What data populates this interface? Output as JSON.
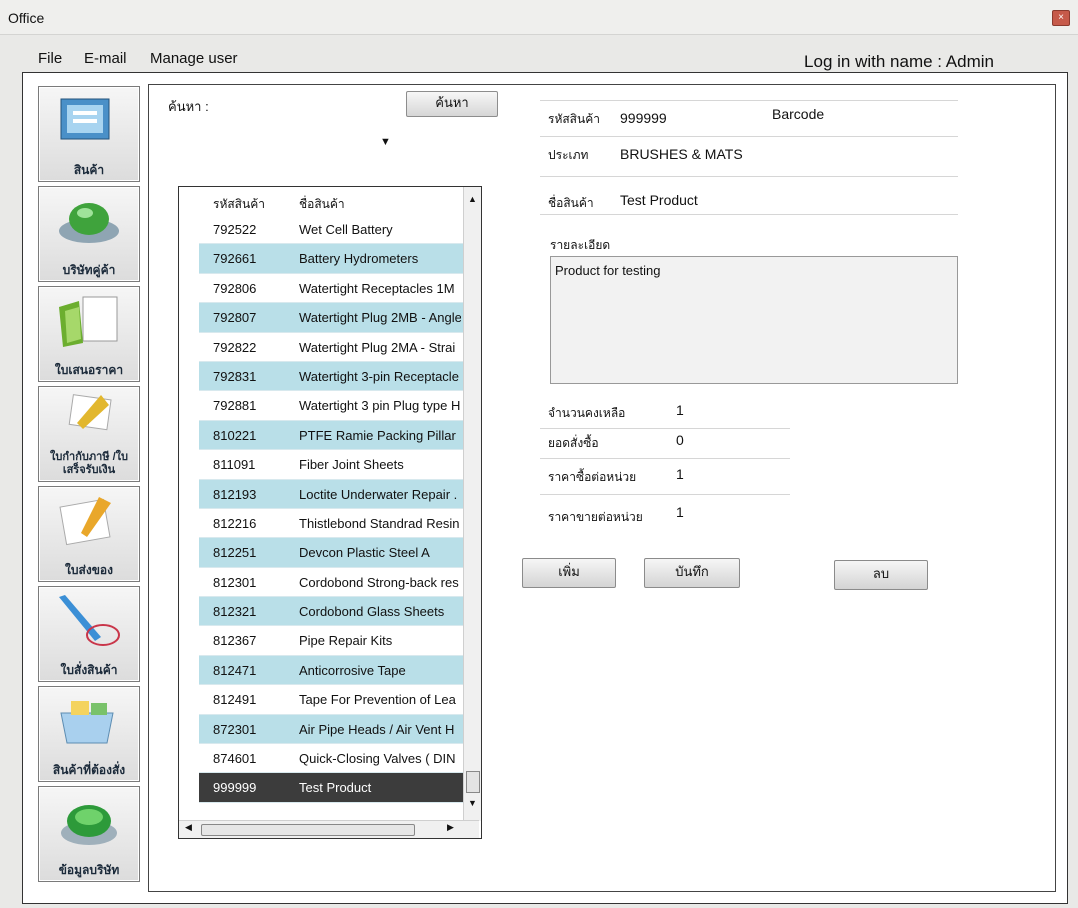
{
  "window": {
    "title": "Office",
    "close_glyph": "×"
  },
  "menu": {
    "file": "File",
    "email": "E-mail",
    "manage_user": "Manage user"
  },
  "login_text": "Log in with name : Admin",
  "sidebar": [
    {
      "label": "สินค้า",
      "icon": "product-icon"
    },
    {
      "label": "บริษัทคู่ค้า",
      "icon": "partner-company-icon"
    },
    {
      "label": "ใบเสนอราคา",
      "icon": "quotation-icon"
    },
    {
      "label": "ใบกำกับภาษี /ใบเสร็จรับเงิน",
      "icon": "invoice-icon"
    },
    {
      "label": "ใบส่งของ",
      "icon": "delivery-note-icon"
    },
    {
      "label": "ใบสั่งสินค้า",
      "icon": "purchase-order-icon"
    },
    {
      "label": "สินค้าที่ต้องสั่ง",
      "icon": "items-to-order-icon"
    },
    {
      "label": "ข้อมูลบริษัท",
      "icon": "company-info-icon"
    }
  ],
  "search": {
    "label": "ค้นหา :",
    "button": "ค้นหา",
    "dropdown_arrow": "▼"
  },
  "list": {
    "headers": {
      "code": "รหัสสินค้า",
      "name": "ชื่อสินค้า"
    },
    "rows": [
      {
        "code": "792522",
        "name": "Wet  Cell Battery"
      },
      {
        "code": "792661",
        "name": "Battery Hydrometers"
      },
      {
        "code": "792806",
        "name": " Watertight Receptacles 1M"
      },
      {
        "code": "792807",
        "name": "Watertight Plug 2MB - Angle"
      },
      {
        "code": "792822",
        "name": " Watertight Plug 2MA - Strai"
      },
      {
        "code": "792831",
        "name": "Watertight 3-pin Receptacle"
      },
      {
        "code": "792881",
        "name": "Watertight 3 pin Plug type H"
      },
      {
        "code": "810221",
        "name": "PTFE Ramie Packing Pillar"
      },
      {
        "code": "811091",
        "name": "Fiber Joint Sheets"
      },
      {
        "code": "812193",
        "name": "Loctite Underwater Repair ."
      },
      {
        "code": "812216",
        "name": "Thistlebond Standrad Resin"
      },
      {
        "code": "812251",
        "name": "Devcon Plastic Steel A"
      },
      {
        "code": "812301",
        "name": "Cordobond Strong-back res"
      },
      {
        "code": "812321",
        "name": "Cordobond Glass Sheets"
      },
      {
        "code": "812367",
        "name": "Pipe Repair Kits"
      },
      {
        "code": "812471",
        "name": "Anticorrosive Tape"
      },
      {
        "code": "812491",
        "name": "Tape For Prevention of Lea"
      },
      {
        "code": "872301",
        "name": "Air Pipe Heads / Air Vent H"
      },
      {
        "code": "874601",
        "name": "Quick-Closing Valves ( DIN"
      },
      {
        "code": "999999",
        "name": "Test Product"
      }
    ],
    "selected_index": 19
  },
  "detail": {
    "code_label": "รหัสสินค้า",
    "code_value": "999999",
    "barcode_label": "Barcode",
    "category_label": "ประเภท",
    "category_value": "BRUSHES & MATS",
    "name_label": "ชื่อสินค้า",
    "name_value": "Test Product",
    "desc_label": "รายละเอียด",
    "desc_value": "Product for testing",
    "stock_label": "จำนวนคงเหลือ",
    "stock_value": "1",
    "ordered_label": "ยอดสั่งซื้อ",
    "ordered_value": "0",
    "buy_price_label": "ราคาซื้อต่อหน่วย",
    "buy_price_value": "1",
    "sell_price_label": "ราคาขายต่อหน่วย",
    "sell_price_value": "1"
  },
  "actions": {
    "add": "เพิ่ม",
    "save": "บันทึก",
    "delete": "ลบ"
  }
}
